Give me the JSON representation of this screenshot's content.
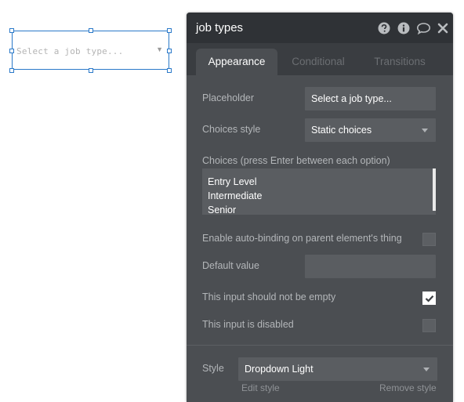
{
  "canvas": {
    "dropdown_placeholder": "Select a job type...",
    "dropdown_arrow": "▼"
  },
  "panel": {
    "title": "job types",
    "header_icons": [
      "help-icon",
      "info-icon",
      "comment-icon",
      "close-icon"
    ],
    "tabs": [
      {
        "label": "Appearance",
        "active": true
      },
      {
        "label": "Conditional",
        "active": false
      },
      {
        "label": "Transitions",
        "active": false
      }
    ],
    "placeholder": {
      "label": "Placeholder",
      "value": "Select a job type..."
    },
    "choices_style": {
      "label": "Choices style",
      "value": "Static choices"
    },
    "choices": {
      "label": "Choices (press Enter between each option)",
      "items": [
        "Entry Level",
        "Intermediate",
        "Senior"
      ]
    },
    "auto_binding": {
      "label": "Enable auto-binding on parent element's thing",
      "checked": false
    },
    "default_value": {
      "label": "Default value",
      "value": ""
    },
    "not_empty": {
      "label": "This input should not be empty",
      "checked": true
    },
    "disabled": {
      "label": "This input is disabled",
      "checked": false
    },
    "style": {
      "label": "Style",
      "value": "Dropdown Light",
      "edit_label": "Edit style",
      "remove_label": "Remove style"
    }
  },
  "colors": {
    "selection_blue": "#2a79c9",
    "panel_bg": "#4b4e52",
    "header_bg": "#2f3236"
  }
}
